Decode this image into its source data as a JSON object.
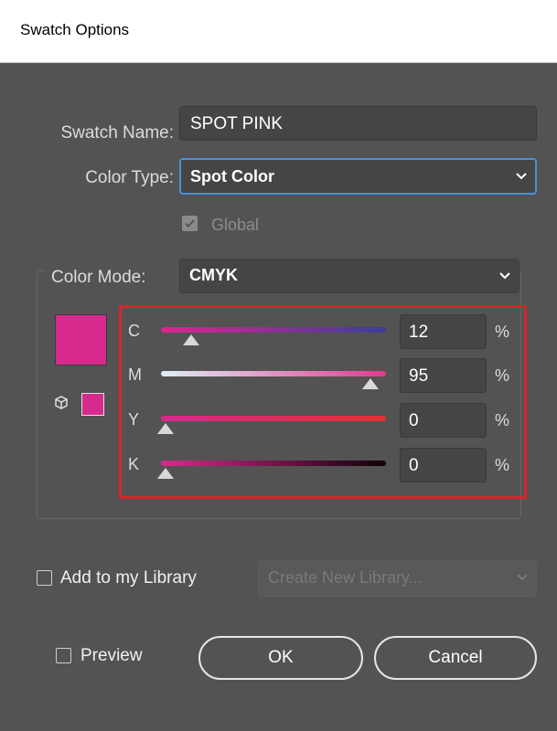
{
  "window": {
    "title": "Swatch Options"
  },
  "swatch_name": {
    "label": "Swatch Name:",
    "value": "SPOT PINK"
  },
  "color_type": {
    "label": "Color Type:",
    "value": "Spot Color"
  },
  "global": {
    "label": "Global",
    "checked": true,
    "disabled": true
  },
  "color_mode": {
    "label": "Color Mode:",
    "value": "CMYK"
  },
  "swatch_color": "#d62a8f",
  "channels": [
    {
      "label": "C",
      "value": "12",
      "unit": "%",
      "fraction": 0.12
    },
    {
      "label": "M",
      "value": "95",
      "unit": "%",
      "fraction": 0.95
    },
    {
      "label": "Y",
      "value": "0",
      "unit": "%",
      "fraction": 0.0
    },
    {
      "label": "K",
      "value": "0",
      "unit": "%",
      "fraction": 0.0
    }
  ],
  "library": {
    "label": "Add to my Library",
    "checked": false,
    "dropdown_value": "Create New Library..."
  },
  "preview": {
    "label": "Preview",
    "checked": false
  },
  "buttons": {
    "ok": "OK",
    "cancel": "Cancel"
  },
  "colors": {
    "highlight": "#d6262b",
    "focus_border": "#4a90d9"
  },
  "icons": {
    "gamut_warning": "cube-icon",
    "dropdown": "chevron-down-icon"
  }
}
